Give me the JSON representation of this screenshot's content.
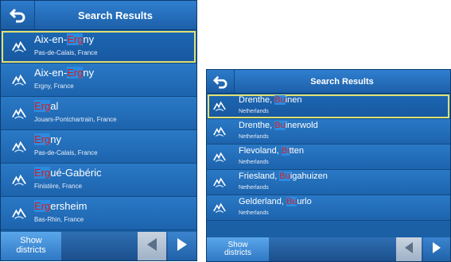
{
  "left_screen": {
    "title": "Search Results",
    "back_icon": "back-arrow-icon",
    "results": [
      {
        "name_parts": [
          "Aix-en-",
          "Erg",
          "ny"
        ],
        "sub": "Pas-de-Calais, France",
        "selected": true,
        "icon": "mountain-pass-icon"
      },
      {
        "name_parts": [
          "Aix-en-",
          "Erg",
          "ny"
        ],
        "sub": "Ergny, France",
        "selected": false,
        "icon": "mountain-pass-icon"
      },
      {
        "name_parts": [
          "",
          "Erg",
          "al"
        ],
        "sub": "Jouars-Pontchartrain, France",
        "selected": false,
        "icon": "mountain-pass-icon"
      },
      {
        "name_parts": [
          "",
          "Erg",
          "ny"
        ],
        "sub": "Pas-de-Calais, France",
        "selected": false,
        "icon": "mountain-pass-icon"
      },
      {
        "name_parts": [
          "",
          "Erg",
          "ué-Gabéric"
        ],
        "sub": "Finistère, France",
        "selected": false,
        "icon": "mountain-pass-icon"
      },
      {
        "name_parts": [
          "",
          "Erg",
          "ersheim"
        ],
        "sub": "Bas-Rhin, France",
        "selected": false,
        "icon": "mountain-pass-icon"
      }
    ],
    "show_districts": [
      "Show",
      "districts"
    ],
    "prev_icon": "previous-page-icon",
    "next_icon": "next-page-icon"
  },
  "right_screen": {
    "title": "Search Results",
    "back_icon": "back-arrow-icon",
    "results": [
      {
        "name_parts": [
          "Drenthe, ",
          "Bu",
          "inen"
        ],
        "sub": "Netherlands",
        "selected": true,
        "icon": "mountain-pass-icon"
      },
      {
        "name_parts": [
          "Drenthe, ",
          "Bu",
          "inerwold"
        ],
        "sub": "Netherlands",
        "selected": false,
        "icon": "mountain-pass-icon"
      },
      {
        "name_parts": [
          "Flevoland, ",
          "Bi",
          "tten"
        ],
        "sub": "Netherlands",
        "selected": false,
        "icon": "mountain-pass-icon"
      },
      {
        "name_parts": [
          "Friesland, ",
          "Bu",
          "igahuizen"
        ],
        "sub": "Netherlands",
        "selected": false,
        "icon": "mountain-pass-icon"
      },
      {
        "name_parts": [
          "Gelderland, ",
          "Bu",
          "urlo"
        ],
        "sub": "Netherlands",
        "selected": false,
        "icon": "mountain-pass-icon"
      }
    ],
    "show_districts": [
      "Show",
      "districts"
    ],
    "prev_icon": "previous-page-icon",
    "next_icon": "next-page-icon"
  },
  "colors": {
    "highlight_text": "#d21c1c",
    "selection_border": "#e0e070",
    "background": "#1d63ad"
  }
}
